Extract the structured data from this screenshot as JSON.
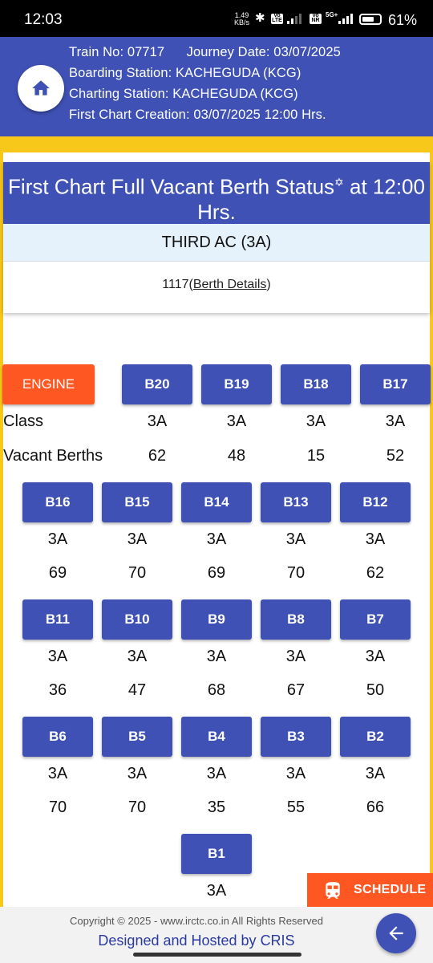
{
  "status_bar": {
    "time": "12:03",
    "speed_value": "1.49",
    "speed_unit": "KB/s",
    "volte1": "Vo LTE",
    "volte2": "Vo NR",
    "net": "5G+",
    "battery": "61%",
    "battery_level": 0.61
  },
  "header": {
    "train_no": "Train No: 07717",
    "journey_date": "Journey Date: 03/07/2025",
    "boarding": "Boarding Station: KACHEGUDA (KCG)",
    "charting": "Charting Station: KACHEGUDA (KCG)",
    "first_chart": "First Chart Creation: 03/07/2025 12:00 Hrs.",
    "home_icon": "home-icon"
  },
  "card": {
    "title_main": "First Chart Full Vacant Berth Status",
    "title_symbol": "✡",
    "title_tail": " at 12:00 Hrs.",
    "class_name": "THIRD AC (3A)",
    "count": "1117",
    "open_paren": "(",
    "link": "Berth Details",
    "close_paren": ")"
  },
  "labels": {
    "engine": "ENGINE",
    "class": "Class",
    "vacant": "Vacant Berths"
  },
  "coaches": [
    {
      "name": "B20",
      "cls": "3A",
      "vacant": "62"
    },
    {
      "name": "B19",
      "cls": "3A",
      "vacant": "48"
    },
    {
      "name": "B18",
      "cls": "3A",
      "vacant": "15"
    },
    {
      "name": "B17",
      "cls": "3A",
      "vacant": "52"
    },
    {
      "name": "B16",
      "cls": "3A",
      "vacant": "69"
    },
    {
      "name": "B15",
      "cls": "3A",
      "vacant": "70"
    },
    {
      "name": "B14",
      "cls": "3A",
      "vacant": "69"
    },
    {
      "name": "B13",
      "cls": "3A",
      "vacant": "70"
    },
    {
      "name": "B12",
      "cls": "3A",
      "vacant": "62"
    },
    {
      "name": "B11",
      "cls": "3A",
      "vacant": "36"
    },
    {
      "name": "B10",
      "cls": "3A",
      "vacant": "47"
    },
    {
      "name": "B9",
      "cls": "3A",
      "vacant": "68"
    },
    {
      "name": "B8",
      "cls": "3A",
      "vacant": "67"
    },
    {
      "name": "B7",
      "cls": "3A",
      "vacant": "50"
    },
    {
      "name": "B6",
      "cls": "3A",
      "vacant": "70"
    },
    {
      "name": "B5",
      "cls": "3A",
      "vacant": "70"
    },
    {
      "name": "B4",
      "cls": "3A",
      "vacant": "35"
    },
    {
      "name": "B3",
      "cls": "3A",
      "vacant": "55"
    },
    {
      "name": "B2",
      "cls": "3A",
      "vacant": "66"
    },
    {
      "name": "B1",
      "cls": "3A",
      "vacant": ""
    }
  ],
  "schedule": {
    "label": "SCHEDULE",
    "icon": "train-icon"
  },
  "footer": {
    "copyright": "Copyright © 2025 - www.irctc.co.in All Rights Reserved",
    "designed": "Designed and Hosted by ",
    "cris": "CRIS",
    "back_icon": "arrow-left-icon"
  },
  "colors": {
    "primary": "#3f51b5",
    "accent": "#ff5722",
    "frame": "#f7c71a",
    "class_band": "#e6f2fb"
  }
}
